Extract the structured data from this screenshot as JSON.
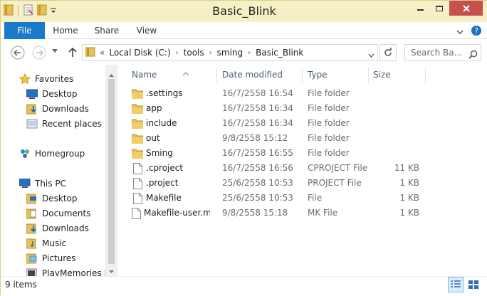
{
  "window": {
    "title": "Basic_Blink",
    "min_label": "",
    "max_label": "",
    "close_label": "×"
  },
  "ribbon": {
    "tabs": [
      "File",
      "Home",
      "Share",
      "View"
    ]
  },
  "navbar": {
    "breadcrumb": {
      "overflow": "«",
      "items": [
        "Local Disk (C:)",
        "tools",
        "sming",
        "Basic_Blink"
      ]
    },
    "search_placeholder": "Search Ba..."
  },
  "navpane": {
    "favorites": {
      "label": "Favorites",
      "items": [
        "Desktop",
        "Downloads",
        "Recent places"
      ]
    },
    "homegroup": "Homegroup",
    "thispc": {
      "label": "This PC",
      "items": [
        "Desktop",
        "Documents",
        "Downloads",
        "Music",
        "Pictures",
        "PlayMemories Ho"
      ]
    }
  },
  "filelist": {
    "columns": {
      "name": "Name",
      "date": "Date modified",
      "type": "Type",
      "size": "Size"
    },
    "rows": [
      {
        "name": ".settings",
        "date": "16/7/2558 16:54",
        "type": "File folder",
        "size": "",
        "kind": "folder"
      },
      {
        "name": "app",
        "date": "16/7/2558 16:34",
        "type": "File folder",
        "size": "",
        "kind": "folder"
      },
      {
        "name": "include",
        "date": "16/7/2558 16:34",
        "type": "File folder",
        "size": "",
        "kind": "folder"
      },
      {
        "name": "out",
        "date": "9/8/2558 15:12",
        "type": "File folder",
        "size": "",
        "kind": "folder"
      },
      {
        "name": "Sming",
        "date": "16/7/2558 16:55",
        "type": "File folder",
        "size": "",
        "kind": "folder"
      },
      {
        "name": ".cproject",
        "date": "16/7/2558 16:56",
        "type": "CPROJECT File",
        "size": "11 KB",
        "kind": "file"
      },
      {
        "name": ".project",
        "date": "25/6/2558 10:53",
        "type": "PROJECT File",
        "size": "1 KB",
        "kind": "file"
      },
      {
        "name": "Makefile",
        "date": "25/6/2558 10:53",
        "type": "File",
        "size": "1 KB",
        "kind": "file"
      },
      {
        "name": "Makefile-user.mk",
        "date": "9/8/2558 15:18",
        "type": "MK File",
        "size": "1 KB",
        "kind": "file"
      }
    ]
  },
  "status": {
    "count": "9 items"
  },
  "colors": {
    "title_bg": "#f5f0c6",
    "file_tab": "#1979ca",
    "close_btn": "#c7504f",
    "folder": "#e8c05a",
    "header_text": "#4c607a"
  }
}
